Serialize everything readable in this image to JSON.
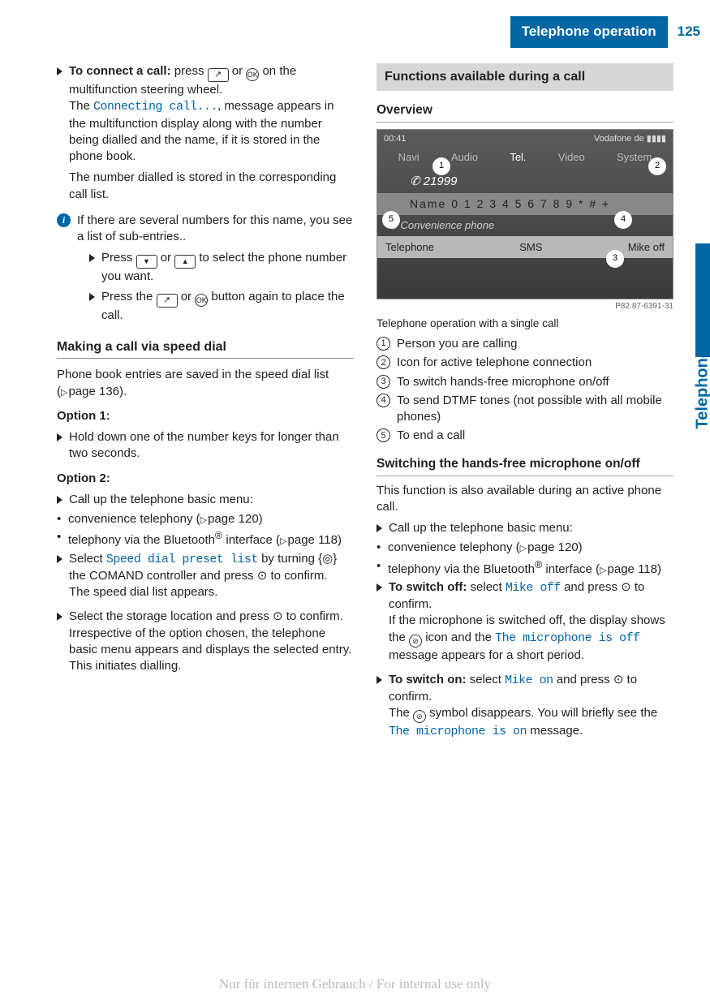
{
  "header": {
    "title": "Telephone operation",
    "page": "125"
  },
  "side_tab": "Telephone",
  "left": {
    "step1": {
      "lead": "To connect a call:",
      "rest": " press ",
      "after_icons": " on the multifunction steering wheel.",
      "line2a": "The ",
      "display1": "Connecting call...",
      "line2b": ", message appears in the multifunction display along with the number being dialled and the name, if it is stored in the phone book.",
      "line3": "The number dialled is stored in the corresponding call list."
    },
    "info1": "If there are several numbers for this name, you see a list of sub-entries..",
    "sub1": {
      "a": "Press ",
      "b": " or ",
      "c": " to select the phone number you want."
    },
    "sub2": {
      "a": "Press the ",
      "b": " or ",
      "c": " button again to place the call."
    },
    "h1": "Making a call via speed dial",
    "p1a": "Phone book entries are saved in the speed dial list (",
    "p1ref": "page 136",
    "p1b": ").",
    "opt1": "Option 1:",
    "opt1_step": "Hold down one of the number keys for longer than two seconds.",
    "opt2": "Option 2:",
    "opt2_step1": "Call up the telephone basic menu:",
    "opt2_b1a": "convenience telephony (",
    "opt2_b1ref": "page 120",
    "opt2_b1b": ")",
    "opt2_b2a": "telephony via the Bluetooth",
    "opt2_b2b": " interface (",
    "opt2_b2ref": "page 118",
    "opt2_b2c": ")",
    "opt2_step2a": "Select ",
    "opt2_step2_disp": "Speed dial preset list",
    "opt2_step2b": " by turning ",
    "opt2_step2c": " the COMAND controller and press ",
    "opt2_step2d": " to confirm.",
    "opt2_step2_res": "The speed dial list appears.",
    "opt2_step3a": "Select the storage location and press ",
    "opt2_step3b": " to confirm.",
    "opt2_step3_res": "Irrespective of the option chosen, the telephone basic menu appears and displays the selected entry. This initiates dialling."
  },
  "right": {
    "block_h": "Functions available during a call",
    "h_overview": "Overview",
    "ss": {
      "time": "00:41",
      "carrier": "Vodafone de",
      "tabs": [
        "Navi",
        "Audio",
        "Tel.",
        "Video",
        "System"
      ],
      "num": "21999",
      "name_row": "Name   0 1 2 3 4 5 6 7 8 9 * # +",
      "conv": "Convenience phone",
      "bot": [
        "Telephone",
        "SMS",
        "Mike off"
      ]
    },
    "img_num": "P82.87-6391-31",
    "caption": "Telephone operation with a single call",
    "legend": [
      "Person you are calling",
      "Icon for active telephone connection",
      "To switch hands-free microphone on/off",
      "To send DTMF tones (not possible with all mobile phones)",
      "To end a call"
    ],
    "h_mic": "Switching the hands-free microphone on/off",
    "mic_p1": "This function is also available during an active phone call.",
    "mic_step1": "Call up the telephone basic menu:",
    "mic_b1a": "convenience telephony (",
    "mic_b1ref": "page 120",
    "mic_b1b": ")",
    "mic_b2a": "telephony via the Bluetooth",
    "mic_b2b": " interface (",
    "mic_b2ref": "page 118",
    "mic_b2c": ")",
    "off_lead": "To switch off:",
    "off_a": " select ",
    "off_disp": "Mike off",
    "off_b": " and press ",
    "off_c": " to confirm.",
    "off_res_a": "If the microphone is switched off, the display shows the ",
    "off_res_b": " icon and the ",
    "off_res_disp": "The microphone is off",
    "off_res_c": " message appears for a short period.",
    "on_lead": "To switch on:",
    "on_a": " select ",
    "on_disp": "Mike on",
    "on_b": " and press ",
    "on_c": " to confirm.",
    "on_res_a": "The ",
    "on_res_b": " symbol disappears. You will briefly see the ",
    "on_res_disp": "The microphone is on",
    "on_res_c": " message."
  },
  "footer": "Nur für internen Gebrauch / For internal use only"
}
